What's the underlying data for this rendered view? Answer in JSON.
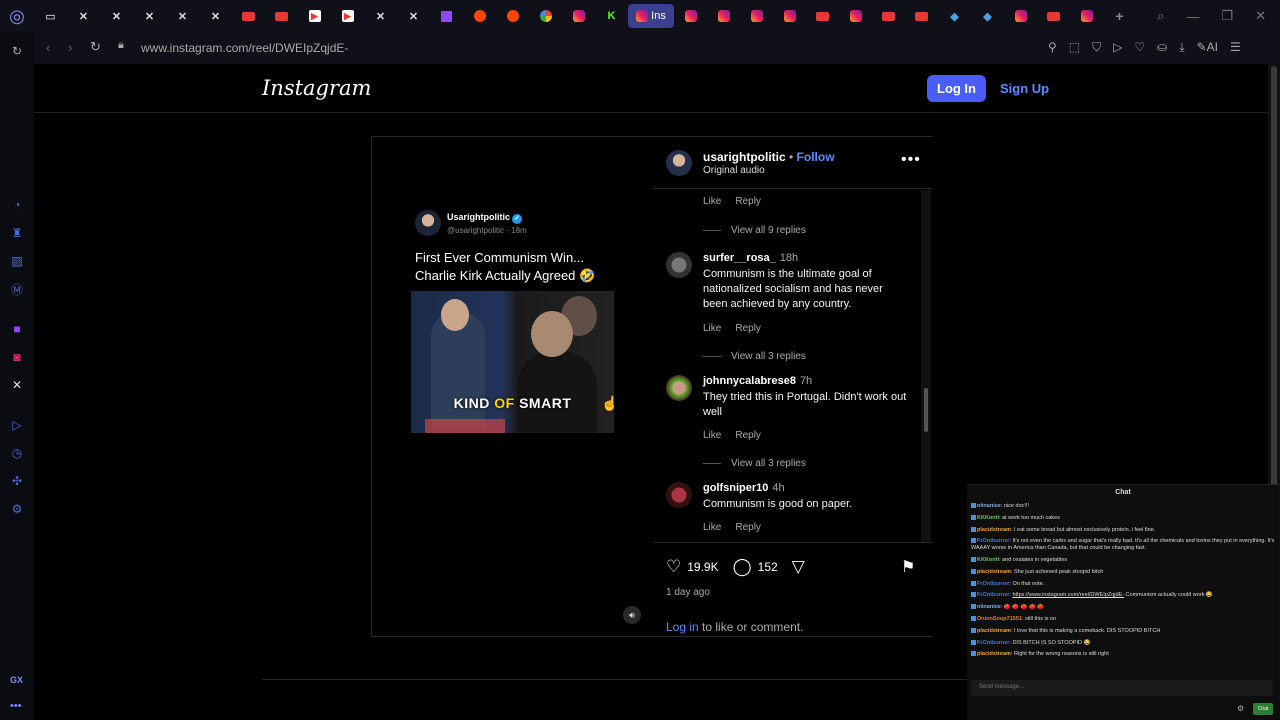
{
  "browser": {
    "url": "www.instagram.com/reel/DWEIpZqjdE-",
    "active_tab_label": "Ins",
    "ai_label": "AI",
    "gx_label": "GX"
  },
  "tabs": [
    "folder",
    "x",
    "x",
    "x",
    "x",
    "x",
    "youtube",
    "youtube",
    "red",
    "red",
    "x",
    "x",
    "twitch",
    "reddit",
    "reddit",
    "google",
    "instagram",
    "kick",
    "instagram-active",
    "instagram",
    "instagram",
    "instagram",
    "instagram",
    "youtube",
    "instagram",
    "youtube",
    "youtube",
    "app",
    "app",
    "instagram",
    "youtube",
    "instagram"
  ],
  "header": {
    "logo": "Instagram",
    "login": "Log In",
    "signup": "Sign Up"
  },
  "video": {
    "tweet_name": "Usarightpolitic",
    "tweet_handle": "@usarightpolitic · 18m",
    "tweet_text_line1": "First Ever Communism Win...",
    "tweet_text_line2": "Charlie Kirk Actually Agreed 🤣",
    "caption_a": "KIND ",
    "caption_b": "OF",
    "caption_c": " SMART"
  },
  "post": {
    "username": "usarightpolitic",
    "dot": " • ",
    "follow": "Follow",
    "audio": "Original audio",
    "like": "Like",
    "reply": "Reply",
    "view_9": "View all 9 replies",
    "view_3": "View all 3 replies",
    "comments": [
      {
        "user": "surfer__rosa_",
        "time": "18h",
        "text": "Communism is the ultimate goal of nationalized socialism and has never been achieved by any country."
      },
      {
        "user": "johnnycalabrese8",
        "time": "7h",
        "text": "They tried this in Portugal. Didn't work out well"
      },
      {
        "user": "golfsniper10",
        "time": "4h",
        "text": "Communism is good on paper."
      }
    ],
    "likes": "19.9K",
    "comment_count": "152",
    "ago": "1 day ago",
    "login_link": "Log in",
    "login_rest": " to like or comment."
  },
  "chat": {
    "title": "Chat",
    "placeholder": "Send message...",
    "send": "Chat",
    "messages": [
      {
        "user": "niinanise",
        "color": "#8ad",
        "text": ": nice doc!!!"
      },
      {
        "user": "KKKonti",
        "color": "#6c6",
        "text": ": at work too much cakes"
      },
      {
        "user": "placidstream",
        "color": "#e9a23b",
        "text": ": I eat some bread but almost exclusively protein. i feel fine."
      },
      {
        "user": "FrOntburner",
        "color": "#3a7bd5",
        "text": ": It's not even the carbs and sugar that's really bad. It's all the chemicals and toxins they put in everything. It's WAAAY worse in America than Canada, but that could be changing fast."
      },
      {
        "user": "KKKonti",
        "color": "#6c6",
        "text": ": and oxalates in vegetables"
      },
      {
        "user": "placidstream",
        "color": "#e9a23b",
        "text": ": She just achieved peak stoopid bitch"
      },
      {
        "user": "FrOntburner",
        "color": "#3a7bd5",
        "text": ": On that note."
      },
      {
        "user": "FrOntburner",
        "color": "#3a7bd5",
        "link": "https://www.instagram.com/reel/DWEIpZqjdE-",
        "text": " Communism actually could work 😂"
      },
      {
        "user": "niinanise",
        "color": "#8ad",
        "text": ": 🍅 🍅 🍅 🍅 🍅"
      },
      {
        "user": "OnionSoup71551",
        "color": "#e67e22",
        "text": ": still this is on"
      },
      {
        "user": "placidstream",
        "color": "#e9a23b",
        "text": ": I love that this is making a comeback. DIS STOOPID BITCH"
      },
      {
        "user": "FrOntburner",
        "color": "#3a7bd5",
        "text": ": DIS BITCH IS SO STOOPID 😂"
      },
      {
        "user": "placidstream",
        "color": "#e9a23b",
        "text": ": Right for the wrong reasons is still right"
      }
    ]
  }
}
